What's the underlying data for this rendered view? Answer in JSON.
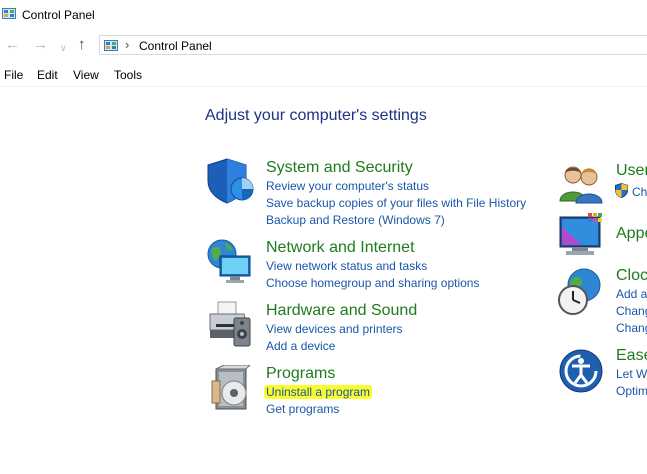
{
  "window": {
    "title": "Control Panel"
  },
  "address": {
    "path_label": "Control Panel"
  },
  "menu": [
    "File",
    "Edit",
    "View",
    "Tools"
  ],
  "heading": "Adjust your computer's settings",
  "categories": {
    "system_security": {
      "title": "System and Security",
      "links": [
        "Review your computer's status",
        "Save backup copies of your files with File History",
        "Backup and Restore (Windows 7)"
      ]
    },
    "network_internet": {
      "title": "Network and Internet",
      "links": [
        "View network status and tasks",
        "Choose homegroup and sharing options"
      ]
    },
    "hardware_sound": {
      "title": "Hardware and Sound",
      "links": [
        "View devices and printers",
        "Add a device"
      ]
    },
    "programs": {
      "title": "Programs",
      "links": [
        "Uninstall a program",
        "Get programs"
      ],
      "highlight_color": "#fbfb2e"
    },
    "user_accounts": {
      "title": "User",
      "links": [
        "Ch"
      ]
    },
    "appearance": {
      "title": "Appe"
    },
    "clock": {
      "title": "Clock",
      "links": [
        "Add a",
        "Chang",
        "Chang"
      ]
    },
    "ease": {
      "title": "Ease",
      "links": [
        "Let W",
        "Optim"
      ]
    }
  },
  "colors": {
    "category_title": "#1e7b1e",
    "link": "#1a57a8",
    "heading": "#1e3287"
  }
}
